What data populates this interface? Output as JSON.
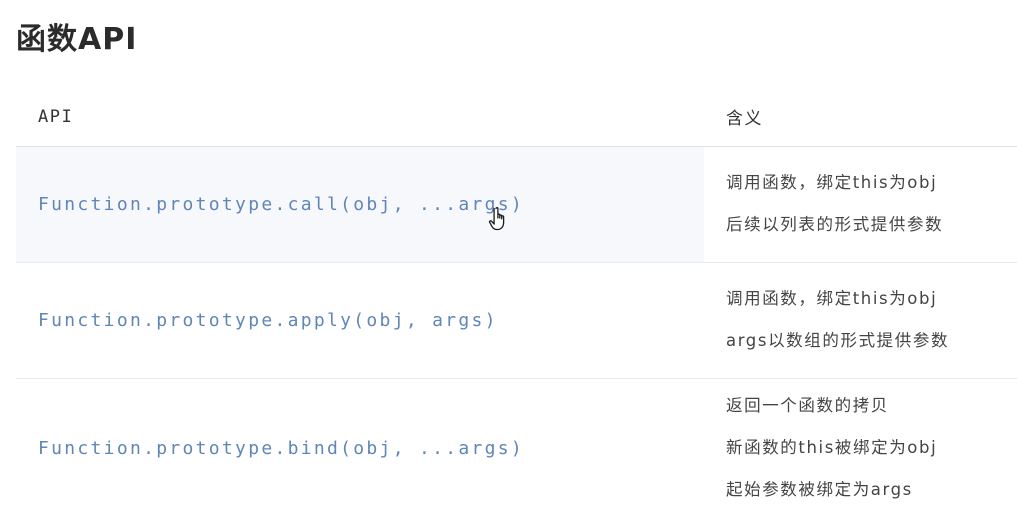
{
  "page": {
    "title": "函数API"
  },
  "table": {
    "headers": {
      "api": "API",
      "meaning": "含义"
    },
    "rows": [
      {
        "api": "Function.prototype.call(obj, ...args)",
        "meaning": [
          "调用函数，绑定this为obj",
          "后续以列表的形式提供参数"
        ]
      },
      {
        "api": "Function.prototype.apply(obj, args)",
        "meaning": [
          "调用函数，绑定this为obj",
          "args以数组的形式提供参数"
        ]
      },
      {
        "api": "Function.prototype.bind(obj, ...args)",
        "meaning": [
          "返回一个函数的拷贝",
          "新函数的this被绑定为obj",
          "起始参数被绑定为args"
        ]
      }
    ]
  },
  "colors": {
    "api_text": "#5f86b8",
    "highlight_row": "#f6f8fb",
    "divider": "#e6e9ee"
  },
  "cursor": {
    "icon": "hand-pointer-icon"
  }
}
